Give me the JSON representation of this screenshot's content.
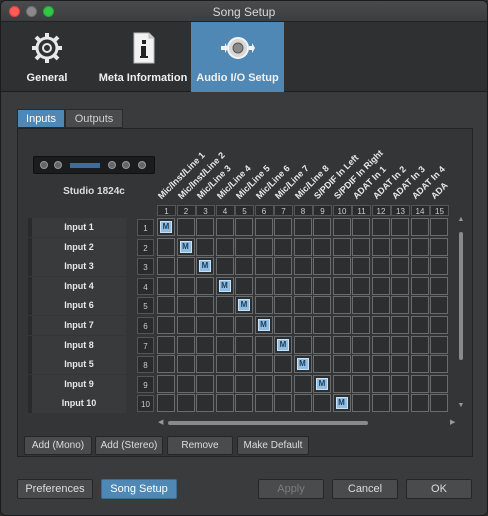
{
  "window": {
    "title": "Song Setup"
  },
  "toolbar": {
    "items": [
      {
        "label": "General",
        "icon": "gear-icon"
      },
      {
        "label": "Meta Information",
        "icon": "info-document-icon"
      },
      {
        "label": "Audio I/O Setup",
        "icon": "audio-io-icon",
        "active": true
      }
    ]
  },
  "tabs": [
    {
      "label": "Inputs",
      "active": true
    },
    {
      "label": "Outputs",
      "active": false
    }
  ],
  "device": {
    "name": "Studio 1824c"
  },
  "columns": [
    {
      "num": "1",
      "label": "Mic/Inst/Line 1"
    },
    {
      "num": "2",
      "label": "Mic/Inst/Line 2"
    },
    {
      "num": "3",
      "label": "Mic/Line 3"
    },
    {
      "num": "4",
      "label": "Mic/Line 4"
    },
    {
      "num": "5",
      "label": "Mic/Line 5"
    },
    {
      "num": "6",
      "label": "Mic/Line 6"
    },
    {
      "num": "7",
      "label": "Mic/Line 7"
    },
    {
      "num": "8",
      "label": "Mic/Line 8"
    },
    {
      "num": "9",
      "label": "S/PDIF In Left"
    },
    {
      "num": "10",
      "label": "S/PDIF In Right"
    },
    {
      "num": "11",
      "label": "ADAT In 1"
    },
    {
      "num": "12",
      "label": "ADAT In 2"
    },
    {
      "num": "13",
      "label": "ADAT In 3"
    },
    {
      "num": "14",
      "label": "ADAT In 4"
    },
    {
      "num": "15",
      "label": "ADA"
    }
  ],
  "rows": [
    {
      "num": "1",
      "label": "Input 1",
      "assigned_col": 1
    },
    {
      "num": "2",
      "label": "Input 2",
      "assigned_col": 2
    },
    {
      "num": "3",
      "label": "Input 3",
      "assigned_col": 3
    },
    {
      "num": "4",
      "label": "Input 4",
      "assigned_col": 4
    },
    {
      "num": "5",
      "label": "Input 6",
      "assigned_col": 5
    },
    {
      "num": "6",
      "label": "Input 7",
      "assigned_col": 6
    },
    {
      "num": "7",
      "label": "Input 8",
      "assigned_col": 7
    },
    {
      "num": "8",
      "label": "Input 5",
      "assigned_col": 8
    },
    {
      "num": "9",
      "label": "Input 9",
      "assigned_col": 9
    },
    {
      "num": "10",
      "label": "Input 10",
      "assigned_col": 10
    }
  ],
  "mark_label": "M",
  "actions": {
    "add_mono": "Add (Mono)",
    "add_stereo": "Add (Stereo)",
    "remove": "Remove",
    "make_default": "Make Default"
  },
  "footer": {
    "preferences": "Preferences",
    "song_setup": "Song Setup",
    "apply": "Apply",
    "cancel": "Cancel",
    "ok": "OK"
  },
  "colors": {
    "accent": "#4f88b5",
    "mark": "#8fbde3",
    "background": "#3a3b3d"
  }
}
